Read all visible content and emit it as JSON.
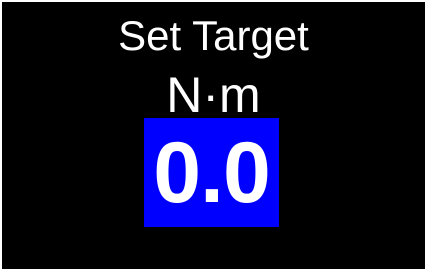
{
  "screen": {
    "title": "Set Target",
    "unit": "N·m",
    "target_value": "0.0"
  },
  "colors": {
    "background": "#000000",
    "text": "#ffffff",
    "value_highlight": "#0000ff"
  }
}
